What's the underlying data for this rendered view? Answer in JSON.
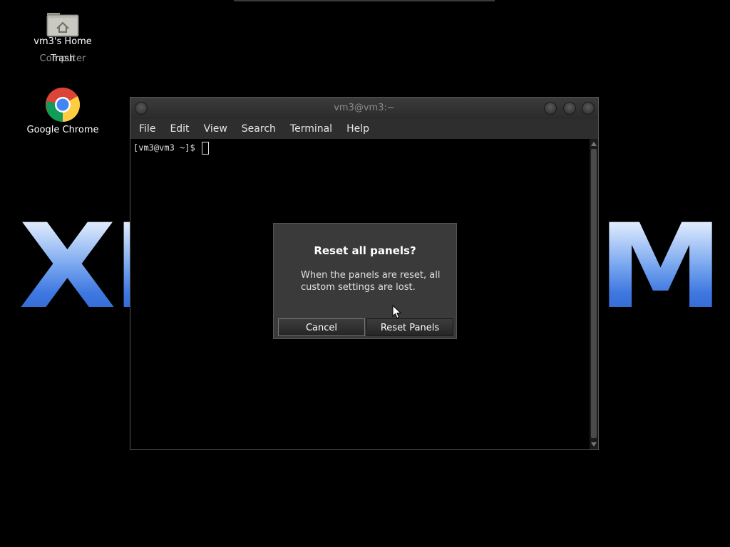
{
  "desktop": {
    "icons": {
      "home_label": "vm3's Home",
      "trash_label": "Trash",
      "computer_label": "Computer",
      "chrome_label": "Google Chrome"
    },
    "wallpaper": {
      "left_text": "XI",
      "right_text": "M",
      "accent": "#4d86e6"
    }
  },
  "terminal": {
    "title": "vm3@vm3:~",
    "menu": [
      "File",
      "Edit",
      "View",
      "Search",
      "Terminal",
      "Help"
    ],
    "prompt": "[vm3@vm3 ~]$"
  },
  "dialog": {
    "title": "Reset all panels?",
    "message": "When the panels are reset, all custom settings are lost.",
    "cancel_label": "Cancel",
    "confirm_label": "Reset Panels"
  },
  "icons": {
    "home": "home-folder-icon",
    "chrome": "chrome-icon",
    "pointer": "mouse-pointer-icon"
  }
}
